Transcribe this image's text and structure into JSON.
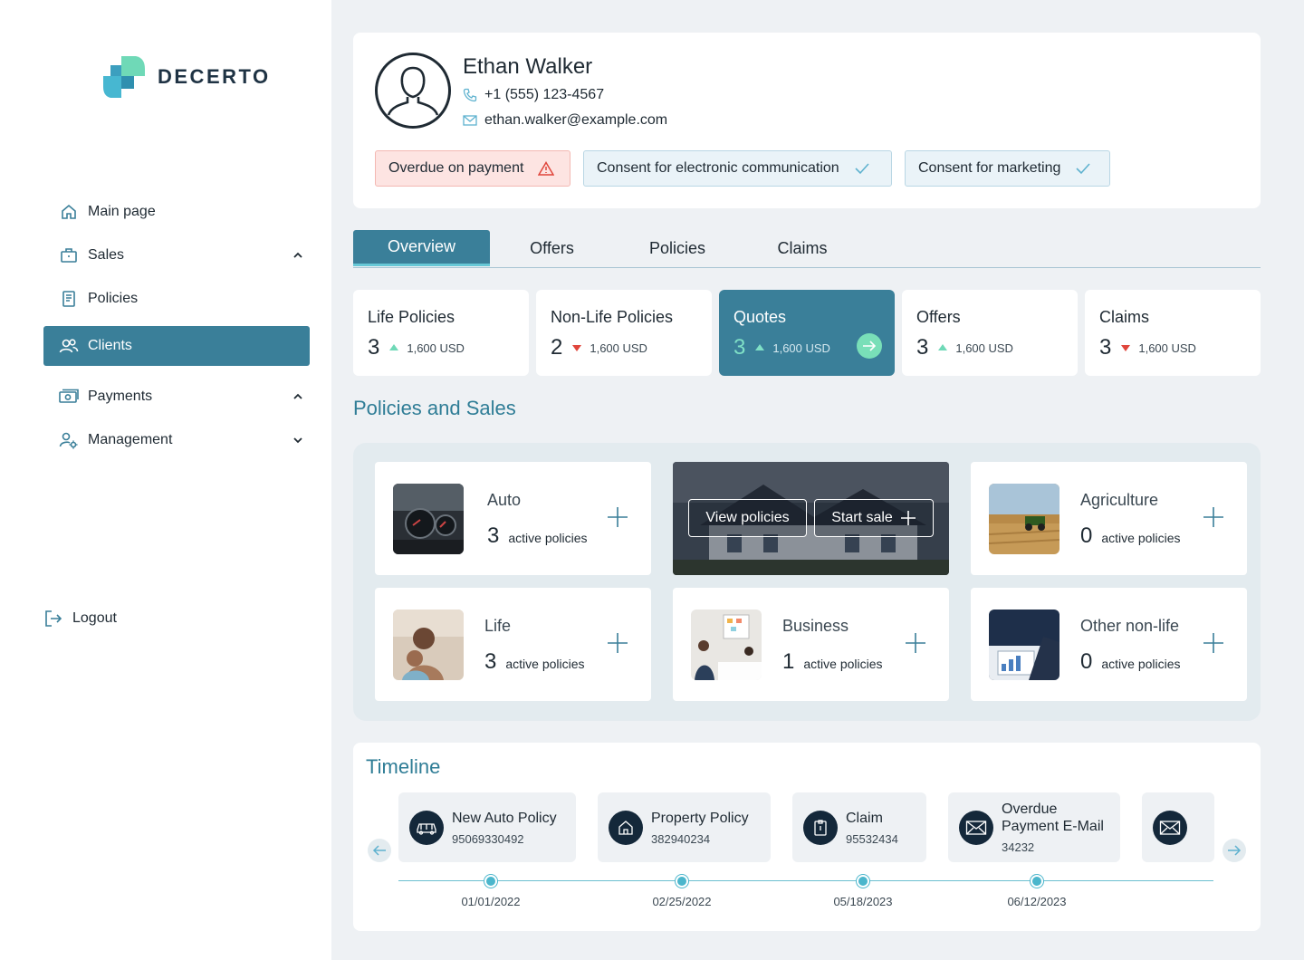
{
  "brand": {
    "name": "DECERTO",
    "colors": {
      "primary": "#3a7f99",
      "accent": "#79dfb8",
      "warn": "#e0453b"
    }
  },
  "sidebar": {
    "items": [
      {
        "label": "Main page",
        "icon": "home-icon"
      },
      {
        "label": "Sales",
        "icon": "briefcase-icon",
        "chevron": "up"
      },
      {
        "label": "Policies",
        "icon": "document-icon"
      },
      {
        "label": "Clients",
        "icon": "users-icon",
        "active": true
      },
      {
        "label": "Payments",
        "icon": "money-icon",
        "chevron": "up"
      },
      {
        "label": "Management",
        "icon": "user-settings-icon",
        "chevron": "down"
      }
    ],
    "logout": "Logout"
  },
  "profile": {
    "name": "Ethan Walker",
    "phone": "+1 (555) 123-4567",
    "email": "ethan.walker@example.com",
    "badges": [
      {
        "label": "Overdue on payment",
        "type": "warning",
        "icon": "warning-icon"
      },
      {
        "label": "Consent for electronic communication",
        "type": "ok",
        "icon": "check-icon"
      },
      {
        "label": "Consent for marketing",
        "type": "ok",
        "icon": "check-icon"
      }
    ]
  },
  "tabs": [
    {
      "label": "Overview",
      "active": true
    },
    {
      "label": "Offers"
    },
    {
      "label": "Policies"
    },
    {
      "label": "Claims"
    }
  ],
  "stats": [
    {
      "title": "Life Policies",
      "count": "3",
      "trend": "up",
      "amount": "1,600 USD"
    },
    {
      "title": "Non-Life Policies",
      "count": "2",
      "trend": "down",
      "amount": "1,600 USD"
    },
    {
      "title": "Quotes",
      "count": "3",
      "trend": "up",
      "amount": "1,600 USD",
      "active": true
    },
    {
      "title": "Offers",
      "count": "3",
      "trend": "up",
      "amount": "1,600 USD"
    },
    {
      "title": "Claims",
      "count": "3",
      "trend": "down",
      "amount": "1,600 USD"
    }
  ],
  "policies_section": {
    "title": "Policies and Sales",
    "suffix": "active policies",
    "items": [
      {
        "label": "Auto",
        "count": "3"
      },
      {
        "label": "Agriculture",
        "count": "0"
      },
      {
        "label": "Life",
        "count": "3"
      },
      {
        "label": "Business",
        "count": "1"
      },
      {
        "label": "Other non-life",
        "count": "0"
      }
    ],
    "feature": {
      "view_label": "View policies",
      "sale_label": "Start sale"
    }
  },
  "timeline": {
    "title": "Timeline",
    "events": [
      {
        "title": "New Auto Policy",
        "number": "95069330492",
        "icon": "car-icon"
      },
      {
        "title": "Property Policy",
        "number": "382940234",
        "icon": "house-icon"
      },
      {
        "title": "Claim",
        "number": "95532434",
        "icon": "clipboard-icon"
      },
      {
        "title": "Overdue Payment E-Mail",
        "number": "34232",
        "icon": "mail-icon"
      },
      {
        "title": "",
        "number": "",
        "icon": "mail-icon"
      }
    ],
    "dates": [
      "01/01/2022",
      "02/25/2022",
      "05/18/2023",
      "06/12/2023"
    ]
  }
}
